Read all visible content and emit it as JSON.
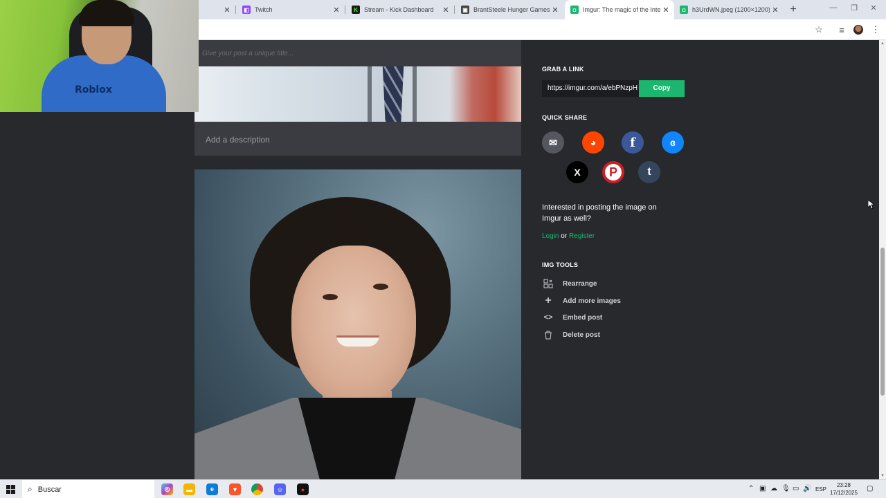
{
  "browser": {
    "tabs": [
      {
        "title": "",
        "favicon": "blank",
        "active": false
      },
      {
        "title": "Twitch",
        "favicon": "twitch-icon",
        "color": "#9146ff",
        "active": false
      },
      {
        "title": "Stream - Kick Dashboard",
        "favicon": "kick-icon",
        "color": "#1a1a1a",
        "active": false
      },
      {
        "title": "BrantSteele Hunger Games Sim",
        "favicon": "brantsteele-icon",
        "color": "#444444",
        "active": false
      },
      {
        "title": "Imgur: The magic of the Interne",
        "favicon": "imgur-icon",
        "color": "#1bb76e",
        "active": true
      },
      {
        "title": "h3UrdWN.jpeg (1200×1200)",
        "favicon": "imgur-icon",
        "color": "#1bb76e",
        "active": false
      }
    ],
    "new_tab": "+",
    "window_controls": [
      "—",
      "❐",
      "✕"
    ]
  },
  "post": {
    "title_placeholder": "Give your post a unique title...",
    "description_placeholder": "Add a description"
  },
  "sidebar": {
    "grab_link": {
      "heading": "GRAB A LINK",
      "url": "https://imgur.com/a/ebPNzpH",
      "copy_label": "Copy"
    },
    "quick_share": {
      "heading": "QUICK SHARE",
      "services": [
        {
          "name": "email-icon",
          "glyph": "✉",
          "color": "#54575e"
        },
        {
          "name": "reddit-icon",
          "glyph": "👽",
          "color": "#ff4500"
        },
        {
          "name": "facebook-icon",
          "glyph": "f",
          "color": "#3b5998"
        },
        {
          "name": "bluesky-icon",
          "glyph": "🦋",
          "color": "#1185fe"
        },
        {
          "name": "x-icon",
          "glyph": "𝕏",
          "color": "#000000"
        },
        {
          "name": "pinterest-icon",
          "glyph": "P",
          "color": "#cb2027"
        },
        {
          "name": "tumblr-icon",
          "glyph": "t",
          "color": "#35465c"
        }
      ]
    },
    "interested": "Interested in posting the image on Imgur as well?",
    "login": "Login",
    "or": "or",
    "register": "Register",
    "img_tools": {
      "heading": "IMG TOOLS",
      "items": [
        {
          "label": "Rearrange",
          "icon": "rearrange-icon",
          "glyph": "⊞"
        },
        {
          "label": "Add more images",
          "icon": "plus-icon",
          "glyph": "+"
        },
        {
          "label": "Embed post",
          "icon": "code-icon",
          "glyph": "<>"
        },
        {
          "label": "Delete post",
          "icon": "trash-icon",
          "glyph": "🗑"
        }
      ]
    }
  },
  "webcam": {
    "shirt_text": "Roblox"
  },
  "taskbar": {
    "search_label": "Buscar",
    "language": "ESP",
    "time": "23:28",
    "date": "17/12/2025"
  }
}
